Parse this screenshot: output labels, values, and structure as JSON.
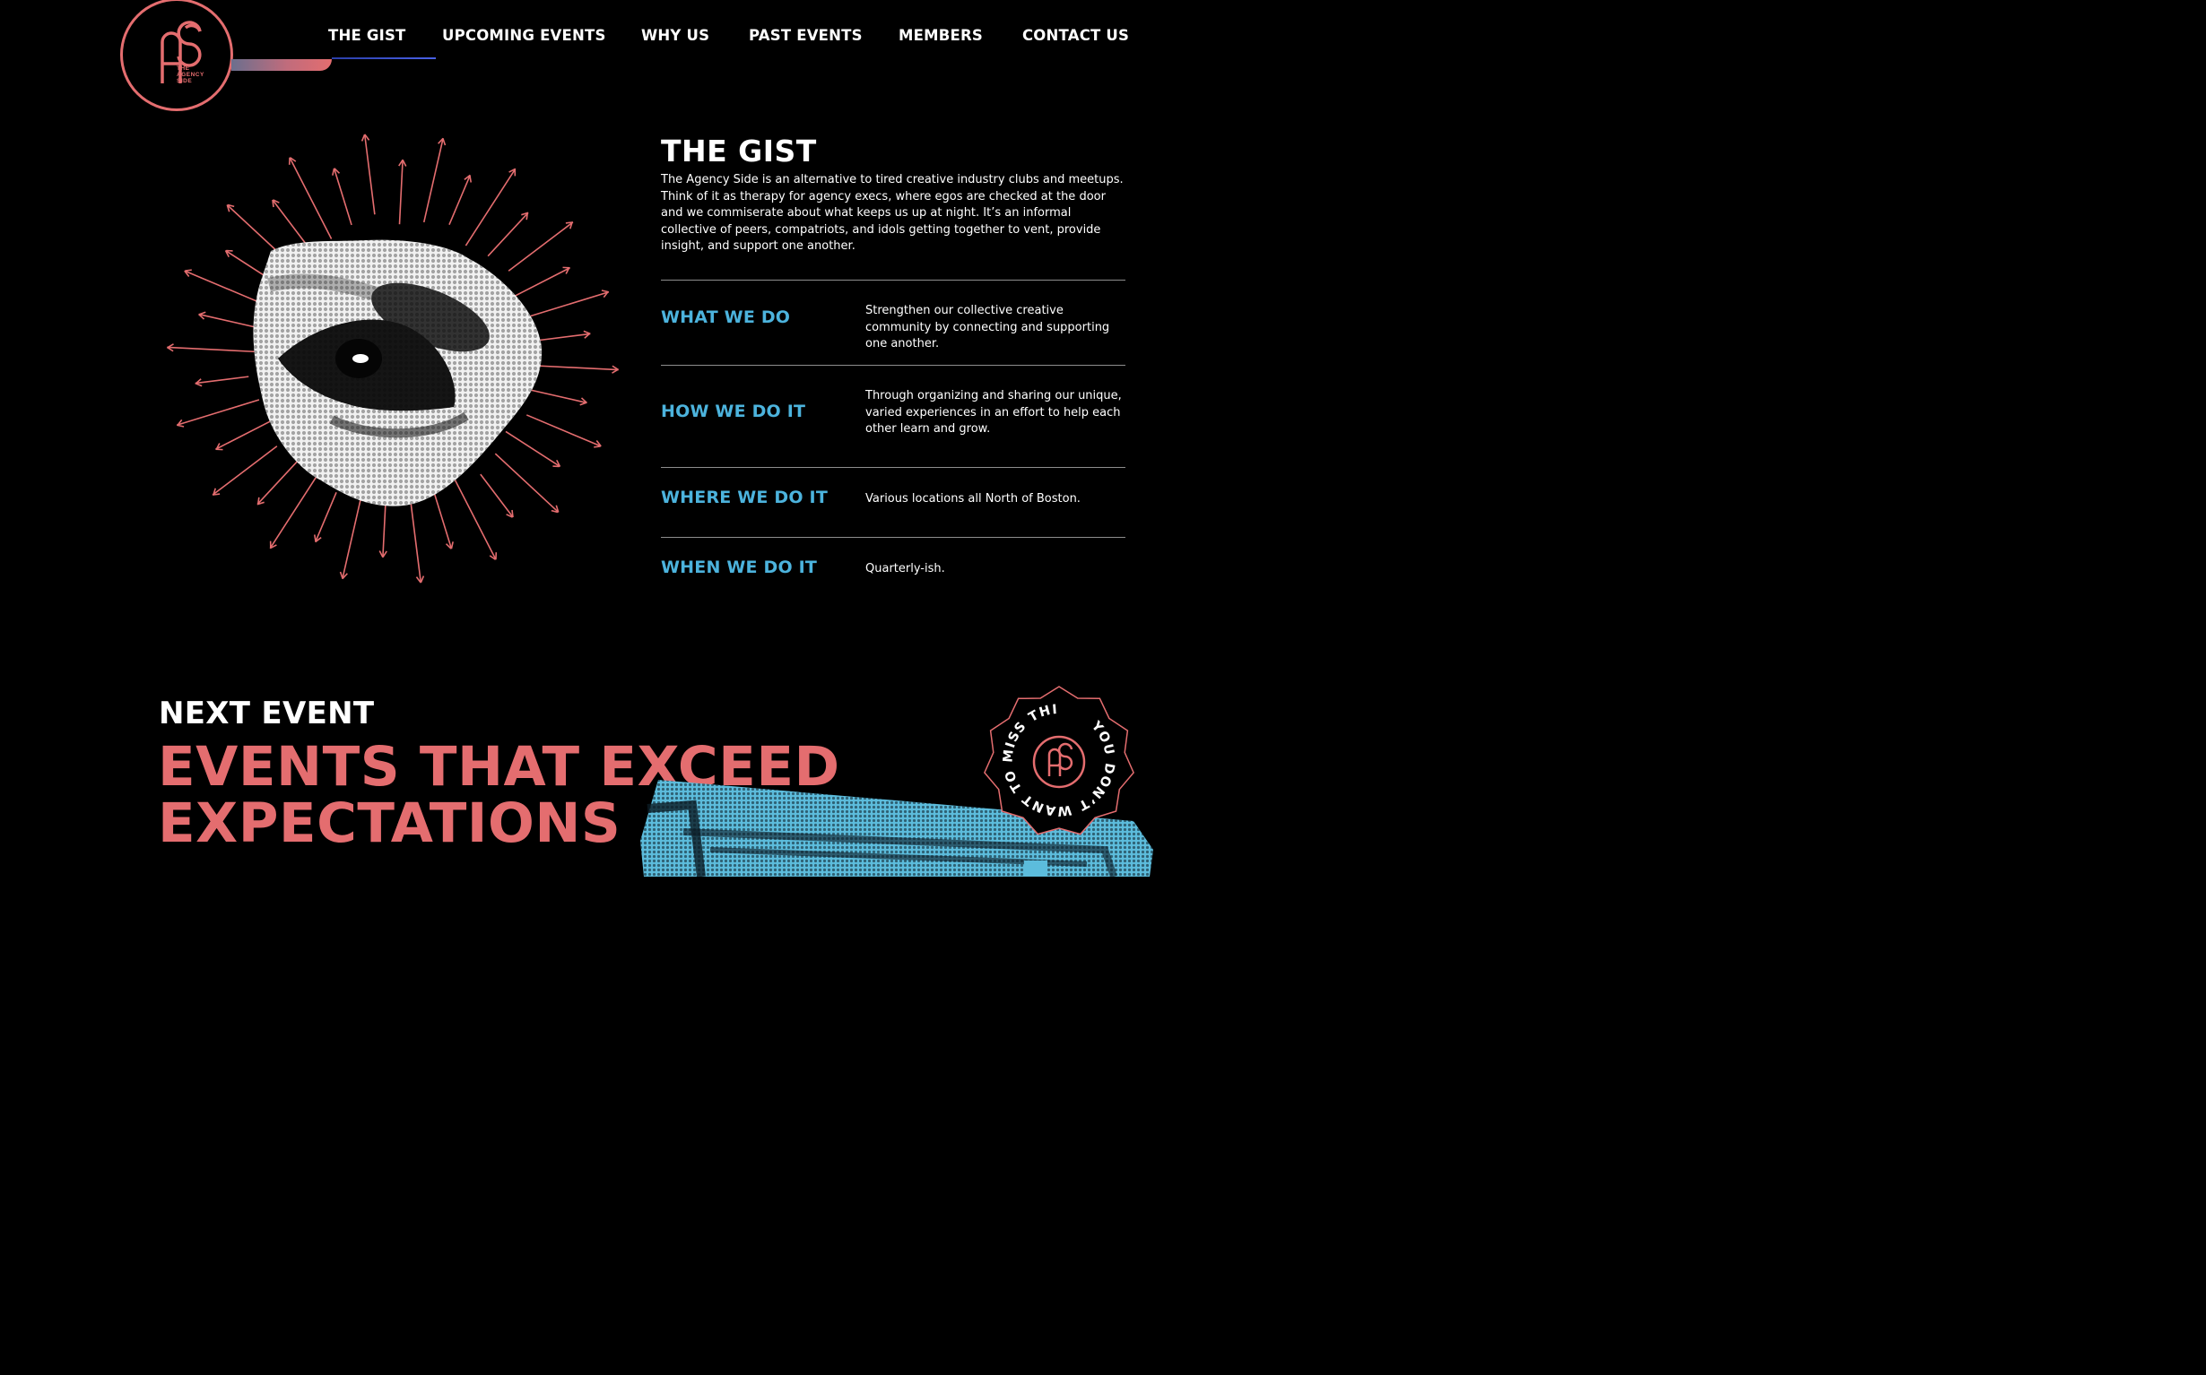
{
  "logo": {
    "initials": "AS",
    "text_line1": "THE",
    "text_line2": "AGENCY",
    "text_line3": "SIDE",
    "accent": "#e46d6f"
  },
  "nav": {
    "items": [
      {
        "label": "THE GIST"
      },
      {
        "label": "UPCOMING EVENTS"
      },
      {
        "label": "WHY US"
      },
      {
        "label": "PAST EVENTS"
      },
      {
        "label": "MEMBERS"
      },
      {
        "label": "CONTACT US"
      }
    ],
    "active_color": "#4961e6"
  },
  "gist": {
    "title": "THE GIST",
    "body": "The Agency Side is an alternative to tired creative industry clubs and meetups. Think of it as therapy for agency execs, where egos are checked at the door and we commiserate about what keeps us up at night. It’s an informal collective of peers, compatriots, and idols getting together to vent, provide insight, and support one another.",
    "rows": [
      {
        "label": "WHAT WE DO",
        "text": "Strengthen our collective creative community by connecting and supporting one another."
      },
      {
        "label": "HOW WE DO IT",
        "text": "Through organizing and sharing our unique, varied experiences in an effort to help each other learn and grow."
      },
      {
        "label": "WHERE WE DO IT",
        "text": "Various locations all North of Boston."
      },
      {
        "label": "WHEN WE DO IT",
        "text": "Quarterly-ish."
      }
    ],
    "label_color": "#4cb3dd"
  },
  "next_event": {
    "heading": "NEXT EVENT",
    "headline_line1": "EVENTS THAT EXCEED",
    "headline_line2": "EXPECTATIONS",
    "badge_text": "YOU DON’T WANT TO MISS THIS EVENT · ",
    "badge_initials": "AS"
  },
  "icons": {
    "hero_image": "halftone-eye-icon",
    "tv_image": "halftone-tv-icon"
  }
}
